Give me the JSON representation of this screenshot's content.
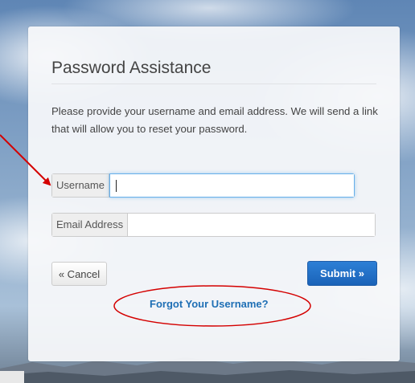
{
  "dialog": {
    "title": "Password Assistance",
    "description": "Please provide your username and email address. We will send a link that will allow you to reset your password."
  },
  "form": {
    "username_label": "Username",
    "username_value": "",
    "email_label": "Email Address",
    "email_value": ""
  },
  "actions": {
    "cancel_label": "« Cancel",
    "submit_label": "Submit »",
    "forgot_username_label": "Forgot Your Username?"
  },
  "colors": {
    "annotation": "#d40000",
    "link": "#1f6fb5",
    "submit": "#1a63b8"
  }
}
